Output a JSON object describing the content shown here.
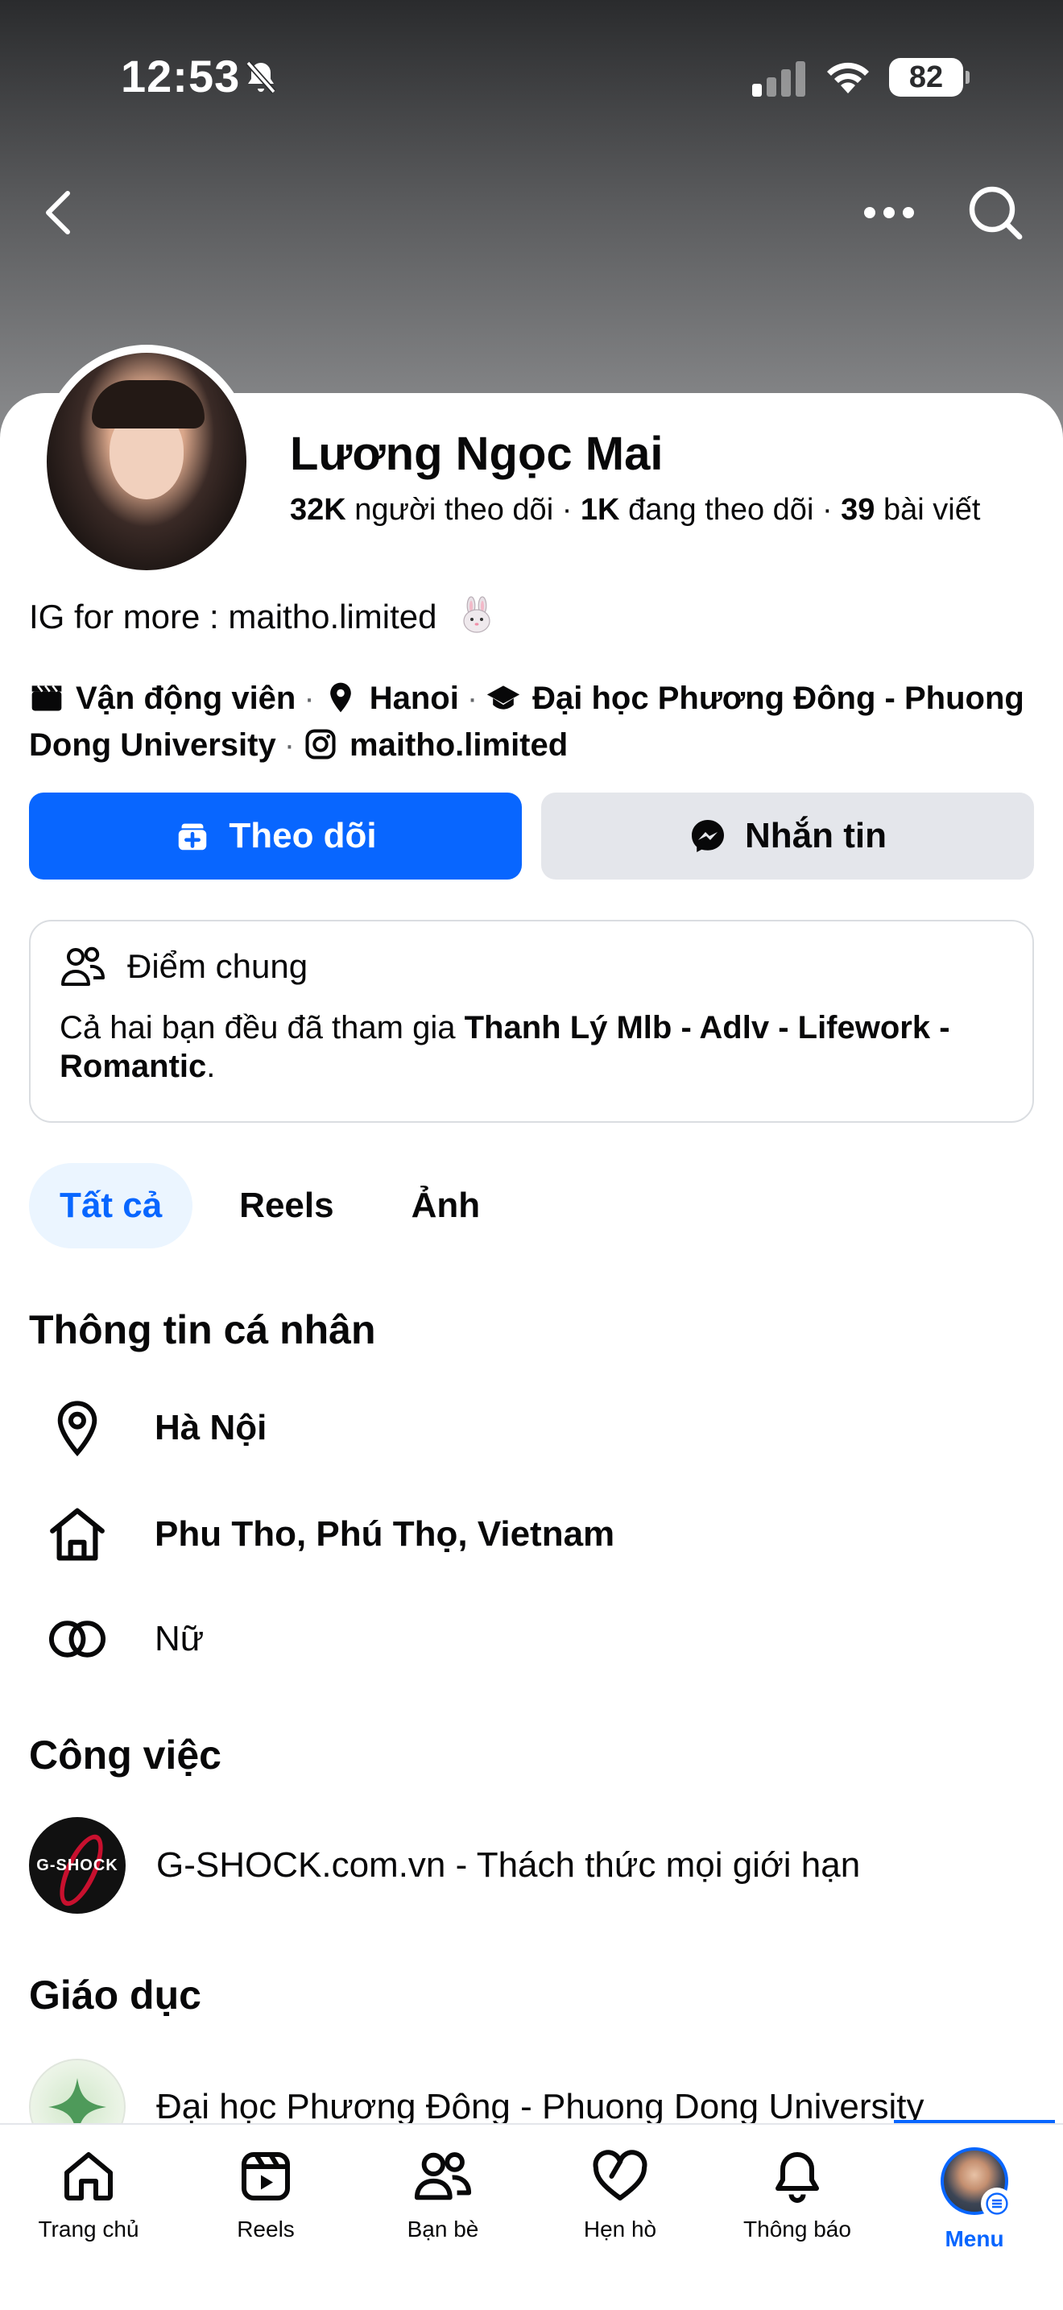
{
  "status_bar": {
    "time": "12:53",
    "battery": "82"
  },
  "profile": {
    "name": "Lương Ngọc Mai",
    "followers_count": "32K",
    "followers_label": "người theo dõi",
    "following_count": "1K",
    "following_label": "đang theo dõi",
    "posts_count": "39",
    "posts_label": "bài viết",
    "bio": "IG for more : maitho.limited",
    "details": {
      "occupation": "Vận động viên",
      "city": "Hanoi",
      "school": "Đại học Phương Đông - Phuong Dong University",
      "instagram": "maitho.limited"
    }
  },
  "actions": {
    "follow": "Theo dõi",
    "message": "Nhắn tin"
  },
  "mutual": {
    "title": "Điểm chung",
    "text_prefix": "Cả hai bạn đều đã tham gia",
    "group": "Thanh Lý Mlb - Adlv - Lifework - Romantic",
    "text_suffix": "."
  },
  "tabs": [
    {
      "label": "Tất cả",
      "active": true
    },
    {
      "label": "Reels",
      "active": false
    },
    {
      "label": "Ảnh",
      "active": false
    }
  ],
  "personal_info": {
    "title": "Thông tin cá nhân",
    "current_city": "Hà Nội",
    "hometown": "Phu Tho, Phú Thọ, Vietnam",
    "gender": "Nữ"
  },
  "work": {
    "title": "Công việc",
    "company": "G-SHOCK.com.vn - Thách thức mọi giới hạn",
    "logo_text": "G-SHOCK"
  },
  "education": {
    "title": "Giáo dục",
    "school": "Đại học Phương Đông - Phuong Dong University"
  },
  "bottom_nav": [
    {
      "label": "Trang chủ",
      "icon": "home-icon"
    },
    {
      "label": "Reels",
      "icon": "reels-icon"
    },
    {
      "label": "Bạn bè",
      "icon": "friends-icon"
    },
    {
      "label": "Hẹn hò",
      "icon": "dating-heart-icon"
    },
    {
      "label": "Thông báo",
      "icon": "bell-icon"
    },
    {
      "label": "Menu",
      "icon": "menu-avatar",
      "active": true
    }
  ],
  "colors": {
    "accent": "#0866ff",
    "secondary_button": "#e4e6eb",
    "active_tab_bg": "#ebf5ff"
  }
}
